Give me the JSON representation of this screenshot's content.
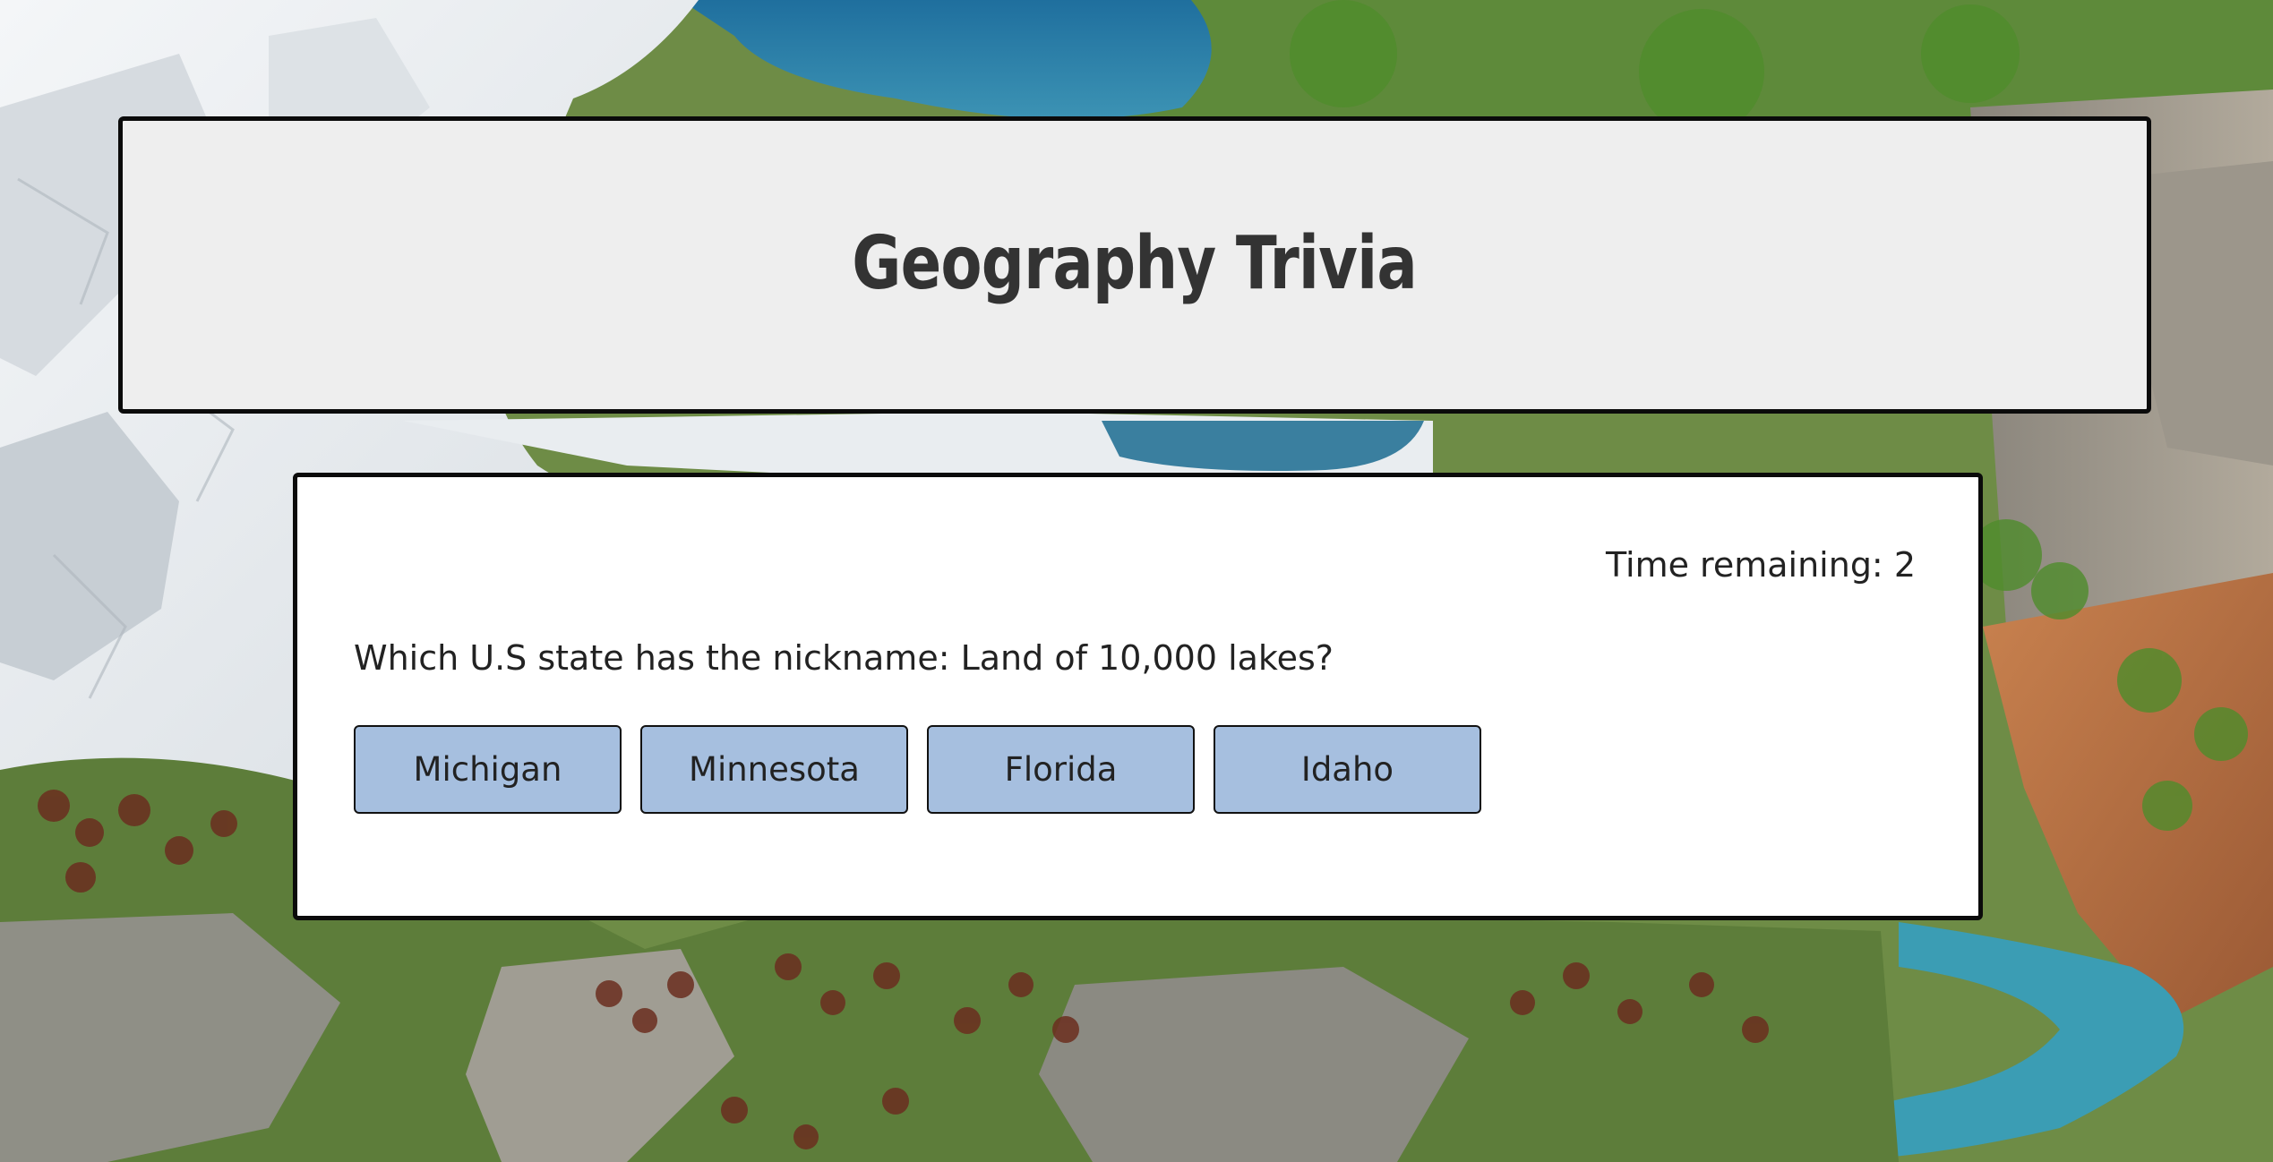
{
  "header": {
    "title": "Geography Trivia"
  },
  "quiz": {
    "timer_label": "Time remaining: 2",
    "question": "Which U.S state has the nickname: Land of 10,000 lakes?",
    "answers": [
      {
        "label": "Michigan"
      },
      {
        "label": "Minnesota"
      },
      {
        "label": "Florida"
      },
      {
        "label": "Idaho"
      }
    ]
  },
  "colors": {
    "header_card_bg": "#eeeeee",
    "quiz_card_bg": "#ffffff",
    "answer_button_bg": "#a6bfdf",
    "border": "#0b0b0b",
    "text": "#222222"
  }
}
